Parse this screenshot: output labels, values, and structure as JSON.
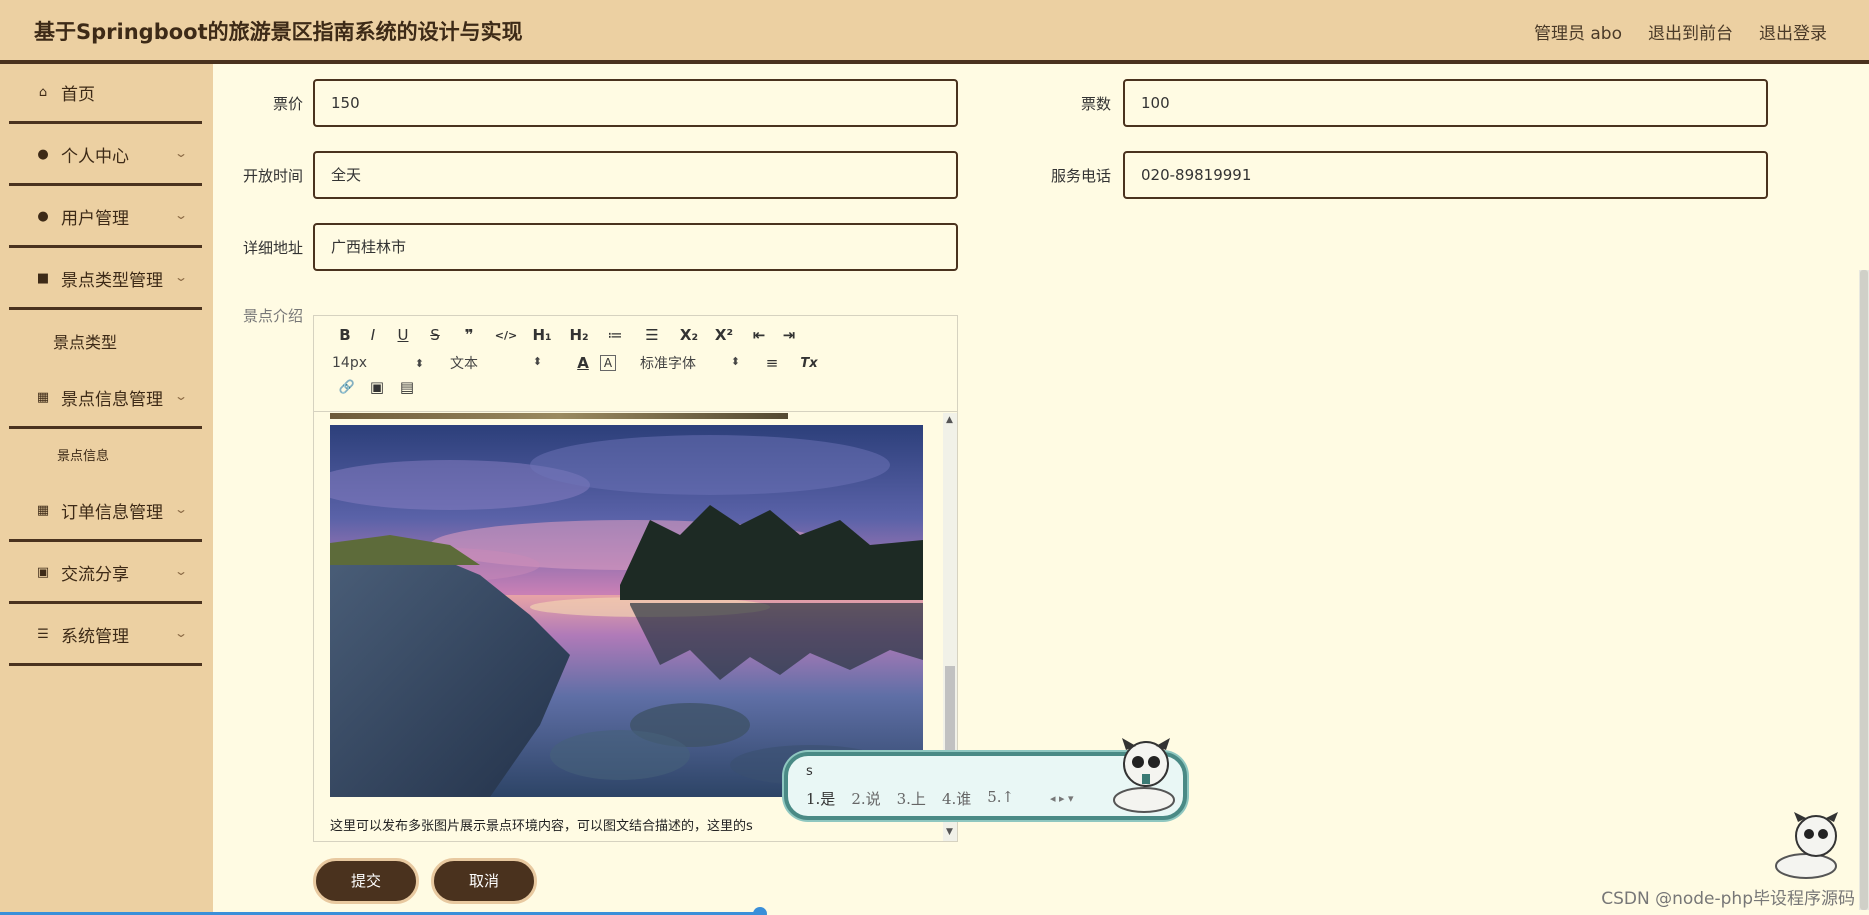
{
  "app": {
    "title": "基于Springboot的旅游景区指南系统的设计与实现"
  },
  "header": {
    "admin_label": "管理员 abo",
    "front_link": "退出到前台",
    "logout_link": "退出登录"
  },
  "sidebar": {
    "items": [
      {
        "label": "首页",
        "icon": "home-icon"
      },
      {
        "label": "个人中心",
        "icon": "person-icon"
      },
      {
        "label": "用户管理",
        "icon": "user-icon"
      },
      {
        "label": "景点类型管理",
        "icon": "wallet-icon"
      },
      {
        "label": "景点信息管理",
        "icon": "grid-icon"
      },
      {
        "label": "订单信息管理",
        "icon": "grid-icon"
      },
      {
        "label": "交流分享",
        "icon": "clipboard-icon"
      },
      {
        "label": "系统管理",
        "icon": "sliders-icon"
      }
    ],
    "sub_type": "景点类型",
    "sub_info": "景点信息"
  },
  "form": {
    "price_label": "票价",
    "price_value": "150",
    "count_label": "票数",
    "count_value": "100",
    "open_label": "开放时间",
    "open_value": "全天",
    "phone_label": "服务电话",
    "phone_value": "020-89819991",
    "address_label": "详细地址",
    "address_value": "广西桂林市",
    "intro_label": "景点介绍"
  },
  "editor": {
    "toolbar": {
      "bold": "B",
      "italic": "I",
      "underline": "U",
      "strike": "S",
      "quote": "❞",
      "code": "</>",
      "h1": "H₁",
      "h2": "H₂",
      "ordered_list": "≔",
      "bullet_list": "☰",
      "subscript": "X₂",
      "superscript": "X²",
      "outdent": "⇤",
      "indent": "⇥",
      "font_size": "14px",
      "text_style": "文本",
      "font_family": "标准字体",
      "color": "A",
      "background": "A",
      "align": "≡",
      "clear": "Tx",
      "link": "🔗",
      "image": "▣",
      "video": "▤"
    },
    "caption": "这里可以发布多张图片展示景点环境内容，可以图文结合描述的，这里的s"
  },
  "ime": {
    "input": "s",
    "candidates": [
      "1.是",
      "2.说",
      "3.上",
      "4.谁",
      "5.↑"
    ]
  },
  "buttons": {
    "submit": "提交",
    "cancel": "取消"
  },
  "watermark": "CSDN @node-php毕设程序源码",
  "colors": {
    "header_bg": "#ecd0a2",
    "accent_dark": "#4a321e",
    "page_bg": "#fffbe3",
    "ime_border": "#4a8a85"
  }
}
